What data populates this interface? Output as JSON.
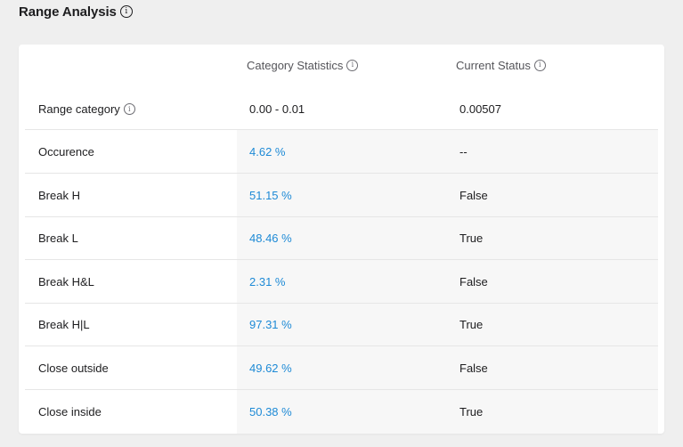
{
  "heading": {
    "title": "Range Analysis",
    "info_glyph": "i"
  },
  "columns": {
    "category_statistics": "Category Statistics",
    "current_status": "Current Status"
  },
  "rows": [
    {
      "label": "Range category",
      "stat": "0.00 - 0.01",
      "status": "0.00507",
      "has_info": true
    },
    {
      "label": "Occurence",
      "stat": "4.62 %",
      "status": "--"
    },
    {
      "label": "Break H",
      "stat": "51.15 %",
      "status": "False"
    },
    {
      "label": "Break L",
      "stat": "48.46 %",
      "status": "True"
    },
    {
      "label": "Break H&L",
      "stat": "2.31 %",
      "status": "False"
    },
    {
      "label": "Break H|L",
      "stat": "97.31 %",
      "status": "True"
    },
    {
      "label": "Close outside",
      "stat": "49.62 %",
      "status": "False"
    },
    {
      "label": "Close inside",
      "stat": "50.38 %",
      "status": "True"
    }
  ],
  "colors": {
    "percent_text": "#1e8ad6",
    "page_background": "#efefef",
    "card_background": "#ffffff",
    "shaded_column": "#f7f7f7"
  },
  "icons": {
    "info": "info-circle-icon"
  }
}
